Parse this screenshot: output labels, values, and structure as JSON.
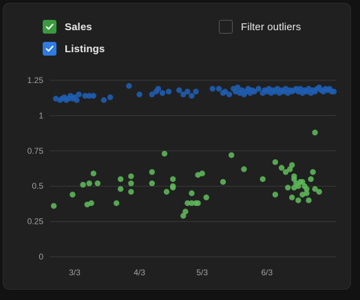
{
  "legend": {
    "sales": {
      "label": "Sales",
      "checked": true,
      "color": "#3a9a3e"
    },
    "listings": {
      "label": "Listings",
      "checked": true,
      "color": "#2f7be0"
    },
    "filter": {
      "label": "Filter outliers",
      "checked": false
    }
  },
  "colors": {
    "sales_points": "#5fb85a",
    "listings_points": "#1f5fb4",
    "grid": "#3a3a3a",
    "card": "#202020"
  },
  "icons": {
    "checkmark": "checkmark-icon"
  },
  "chart_data": {
    "type": "scatter",
    "title": "",
    "xlabel": "",
    "ylabel": "",
    "ylim": [
      0,
      1.25
    ],
    "yticks": [
      {
        "value": 0,
        "label": "0"
      },
      {
        "value": 0.25,
        "label": "0.25"
      },
      {
        "value": 0.5,
        "label": "0.5"
      },
      {
        "value": 0.75,
        "label": "0.75"
      },
      {
        "value": 1,
        "label": "1"
      },
      {
        "value": 1.25,
        "label": "1.25"
      }
    ],
    "xlim": [
      "2024-02-20",
      "2024-07-06"
    ],
    "xticks": [
      {
        "value": "2024-03-03",
        "label": "3/3"
      },
      {
        "value": "2024-04-03",
        "label": "4/3"
      },
      {
        "value": "2024-05-03",
        "label": "5/3"
      },
      {
        "value": "2024-06-03",
        "label": "6/3"
      }
    ],
    "grid": true,
    "legend_position": "top",
    "series": [
      {
        "name": "Listings",
        "color": "#1f5fb4",
        "points": [
          [
            "2024-02-23",
            1.12
          ],
          [
            "2024-02-25",
            1.11
          ],
          [
            "2024-02-26",
            1.12
          ],
          [
            "2024-02-27",
            1.13
          ],
          [
            "2024-02-28",
            1.11
          ],
          [
            "2024-02-29",
            1.12
          ],
          [
            "2024-03-01",
            1.14
          ],
          [
            "2024-03-02",
            1.12
          ],
          [
            "2024-03-03",
            1.13
          ],
          [
            "2024-03-04",
            1.11
          ],
          [
            "2024-03-05",
            1.15
          ],
          [
            "2024-03-08",
            1.14
          ],
          [
            "2024-03-10",
            1.14
          ],
          [
            "2024-03-12",
            1.14
          ],
          [
            "2024-03-17",
            1.11
          ],
          [
            "2024-03-20",
            1.13
          ],
          [
            "2024-03-29",
            1.21
          ],
          [
            "2024-04-03",
            1.15
          ],
          [
            "2024-04-09",
            1.15
          ],
          [
            "2024-04-11",
            1.17
          ],
          [
            "2024-04-12",
            1.19
          ],
          [
            "2024-04-14",
            1.16
          ],
          [
            "2024-04-17",
            1.17
          ],
          [
            "2024-04-22",
            1.18
          ],
          [
            "2024-04-24",
            1.15
          ],
          [
            "2024-04-26",
            1.17
          ],
          [
            "2024-04-28",
            1.14
          ],
          [
            "2024-04-30",
            1.17
          ],
          [
            "2024-05-08",
            1.19
          ],
          [
            "2024-05-11",
            1.19
          ],
          [
            "2024-05-13",
            1.16
          ],
          [
            "2024-05-14",
            1.17
          ],
          [
            "2024-05-16",
            1.15
          ],
          [
            "2024-05-18",
            1.19
          ],
          [
            "2024-05-19",
            1.17
          ],
          [
            "2024-05-20",
            1.2
          ],
          [
            "2024-05-21",
            1.16
          ],
          [
            "2024-05-22",
            1.18
          ],
          [
            "2024-05-24",
            1.17
          ],
          [
            "2024-05-25",
            1.19
          ],
          [
            "2024-05-26",
            1.16
          ],
          [
            "2024-05-27",
            1.18
          ],
          [
            "2024-05-28",
            1.17
          ],
          [
            "2024-05-30",
            1.19
          ],
          [
            "2024-06-01",
            1.16
          ],
          [
            "2024-06-02",
            1.18
          ],
          [
            "2024-06-03",
            1.17
          ],
          [
            "2024-06-04",
            1.19
          ],
          [
            "2024-06-05",
            1.16
          ],
          [
            "2024-06-06",
            1.18
          ],
          [
            "2024-06-07",
            1.17
          ],
          [
            "2024-06-08",
            1.19
          ],
          [
            "2024-06-09",
            1.16
          ],
          [
            "2024-06-10",
            1.18
          ],
          [
            "2024-06-11",
            1.17
          ],
          [
            "2024-06-12",
            1.19
          ],
          [
            "2024-06-13",
            1.16
          ],
          [
            "2024-06-14",
            1.18
          ],
          [
            "2024-06-15",
            1.17
          ],
          [
            "2024-06-16",
            1.18
          ],
          [
            "2024-06-17",
            1.19
          ],
          [
            "2024-06-18",
            1.17
          ],
          [
            "2024-06-19",
            1.19
          ],
          [
            "2024-06-20",
            1.16
          ],
          [
            "2024-06-21",
            1.18
          ],
          [
            "2024-06-22",
            1.17
          ],
          [
            "2024-06-23",
            1.19
          ],
          [
            "2024-06-24",
            1.16
          ],
          [
            "2024-06-25",
            1.18
          ],
          [
            "2024-06-26",
            1.17
          ],
          [
            "2024-06-27",
            1.19
          ],
          [
            "2024-06-28",
            1.2
          ],
          [
            "2024-06-29",
            1.18
          ],
          [
            "2024-06-30",
            1.17
          ],
          [
            "2024-07-01",
            1.19
          ],
          [
            "2024-07-02",
            1.18
          ],
          [
            "2024-07-03",
            1.19
          ],
          [
            "2024-07-04",
            1.17
          ],
          [
            "2024-07-05",
            1.17
          ],
          [
            "2024-05-23",
            1.15
          ]
        ]
      },
      {
        "name": "Sales",
        "color": "#5fb85a",
        "points": [
          [
            "2024-02-22",
            0.36
          ],
          [
            "2024-03-02",
            0.44
          ],
          [
            "2024-03-07",
            0.51
          ],
          [
            "2024-03-09",
            0.37
          ],
          [
            "2024-03-10",
            0.52
          ],
          [
            "2024-03-11",
            0.38
          ],
          [
            "2024-03-12",
            0.59
          ],
          [
            "2024-03-14",
            0.52
          ],
          [
            "2024-03-23",
            0.38
          ],
          [
            "2024-03-25",
            0.48
          ],
          [
            "2024-03-25",
            0.55
          ],
          [
            "2024-03-30",
            0.57
          ],
          [
            "2024-03-30",
            0.52
          ],
          [
            "2024-03-30",
            0.46
          ],
          [
            "2024-04-09",
            0.6
          ],
          [
            "2024-04-09",
            0.52
          ],
          [
            "2024-04-15",
            0.73
          ],
          [
            "2024-04-16",
            0.46
          ],
          [
            "2024-04-19",
            0.49
          ],
          [
            "2024-04-19",
            0.5
          ],
          [
            "2024-04-19",
            0.55
          ],
          [
            "2024-04-24",
            0.29
          ],
          [
            "2024-04-25",
            0.32
          ],
          [
            "2024-04-26",
            0.38
          ],
          [
            "2024-04-28",
            0.45
          ],
          [
            "2024-04-28",
            0.38
          ],
          [
            "2024-04-30",
            0.38
          ],
          [
            "2024-05-01",
            0.38
          ],
          [
            "2024-05-01",
            0.58
          ],
          [
            "2024-05-03",
            0.59
          ],
          [
            "2024-05-05",
            0.42
          ],
          [
            "2024-05-13",
            0.53
          ],
          [
            "2024-05-17",
            0.72
          ],
          [
            "2024-05-23",
            0.62
          ],
          [
            "2024-06-01",
            0.55
          ],
          [
            "2024-06-07",
            0.44
          ],
          [
            "2024-06-07",
            0.67
          ],
          [
            "2024-06-10",
            0.63
          ],
          [
            "2024-06-12",
            0.6
          ],
          [
            "2024-06-14",
            0.62
          ],
          [
            "2024-06-15",
            0.65
          ],
          [
            "2024-06-16",
            0.57
          ],
          [
            "2024-06-16",
            0.49
          ],
          [
            "2024-06-17",
            0.52
          ],
          [
            "2024-06-18",
            0.5
          ],
          [
            "2024-06-19",
            0.53
          ],
          [
            "2024-06-20",
            0.53
          ],
          [
            "2024-06-21",
            0.5
          ],
          [
            "2024-06-22",
            0.45
          ],
          [
            "2024-06-23",
            0.4
          ],
          [
            "2024-06-24",
            0.55
          ],
          [
            "2024-06-25",
            0.6
          ],
          [
            "2024-06-26",
            0.48
          ],
          [
            "2024-06-26",
            0.88
          ],
          [
            "2024-06-28",
            0.46
          ],
          [
            "2024-06-15",
            0.42
          ],
          [
            "2024-06-18",
            0.4
          ],
          [
            "2024-06-13",
            0.49
          ],
          [
            "2024-06-16",
            0.55
          ],
          [
            "2024-06-22",
            0.48
          ],
          [
            "2024-06-20",
            0.44
          ]
        ]
      }
    ]
  }
}
